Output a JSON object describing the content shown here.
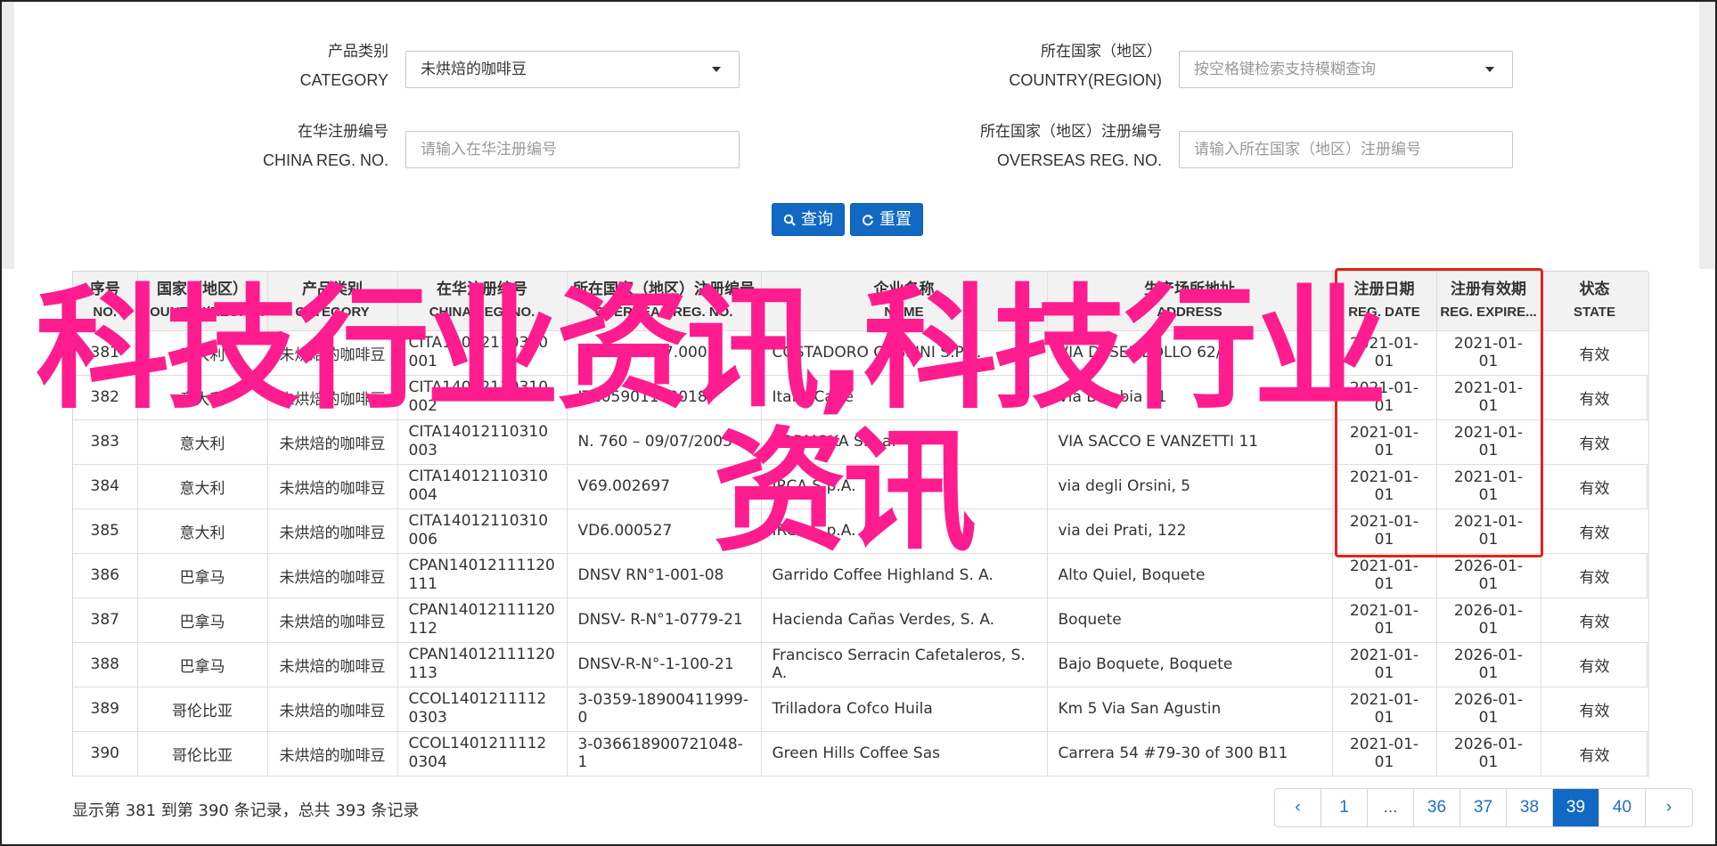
{
  "search": {
    "category_label_cn": "产品类别",
    "category_label_en": "CATEGORY",
    "category_value": "未烘焙的咖啡豆",
    "country_label_cn": "所在国家（地区）",
    "country_label_en": "COUNTRY(REGION)",
    "country_placeholder": "按空格键检索支持模糊查询",
    "china_reg_label_cn": "在华注册编号",
    "china_reg_label_en": "CHINA REG. NO.",
    "china_reg_placeholder": "请输入在华注册编号",
    "overseas_reg_label_cn": "所在国家（地区）注册编号",
    "overseas_reg_label_en": "OVERSEAS REG. NO.",
    "overseas_reg_placeholder": "请输入所在国家（地区）注册编号",
    "query_button": "查询",
    "reset_button": "重置"
  },
  "table": {
    "headers": [
      {
        "cn": "序号",
        "en": "NO."
      },
      {
        "cn": "国家（地区）",
        "en": "COUNTRY(REGIO..."
      },
      {
        "cn": "产品类别",
        "en": "CATEGORY"
      },
      {
        "cn": "在华注册编号",
        "en": "CHINA REG. NO."
      },
      {
        "cn": "所在国家（地区）注册编号",
        "en": "OVERSEAS REG. NO."
      },
      {
        "cn": "企业名称",
        "en": "NAME"
      },
      {
        "cn": "生产场所地址",
        "en": "ADDRESS"
      },
      {
        "cn": "注册日期",
        "en": "REG. DATE"
      },
      {
        "cn": "注册有效期",
        "en": "REG. EXPIRE..."
      },
      {
        "cn": "状态",
        "en": "STATE"
      }
    ],
    "rows": [
      [
        "381",
        "意大利",
        "未烘焙的咖啡豆",
        "CITA14012110310001",
        "IT09.S10117.0001",
        "COSTADORO COSSINI S.P.A.",
        "VIA DESEMBOLLO 62/A",
        "2021-01-01",
        "2021-01-01",
        "有效"
      ],
      [
        "382",
        "意大利",
        "未烘焙的咖啡豆",
        "CITA14012110310002",
        "IT205901100018",
        "Italvi Caffè",
        "Via Bolobia 21",
        "2021-01-01",
        "2021-01-01",
        "有效"
      ],
      [
        "383",
        "意大利",
        "未烘焙的咖啡豆",
        "CITA14012110310003",
        "N. 760 – 09/07/2003",
        "TORMOKA S.a.a.",
        "VIA SACCO E VANZETTI 11",
        "2021-01-01",
        "2021-01-01",
        "有效"
      ],
      [
        "384",
        "意大利",
        "未烘焙的咖啡豆",
        "CITA14012110310004",
        "V69.002697",
        "IRCA S.p.A.",
        "via degli Orsini, 5",
        "2021-01-01",
        "2021-01-01",
        "有效"
      ],
      [
        "385",
        "意大利",
        "未烘焙的咖啡豆",
        "CITA14012110310006",
        "VD6.000527",
        "IRCA S.p.A.",
        "via dei Prati, 122",
        "2021-01-01",
        "2021-01-01",
        "有效"
      ],
      [
        "386",
        "巴拿马",
        "未烘焙的咖啡豆",
        "CPAN14012111120111",
        "DNSV RN°1-001-08",
        "Garrido Coffee Highland S. A.",
        "Alto Quiel, Boquete",
        "2021-01-01",
        "2026-01-01",
        "有效"
      ],
      [
        "387",
        "巴拿马",
        "未烘焙的咖啡豆",
        "CPAN14012111120112",
        "DNSV- R-N°1-0779-21",
        "Hacienda Cañas Verdes, S. A.",
        "Boquete",
        "2021-01-01",
        "2026-01-01",
        "有效"
      ],
      [
        "388",
        "巴拿马",
        "未烘焙的咖啡豆",
        "CPAN14012111120113",
        "DNSV-R-N°-1-100-21",
        "Francisco Serracin Cafetaleros, S. A.",
        "Bajo Boquete, Boquete",
        "2021-01-01",
        "2026-01-01",
        "有效"
      ],
      [
        "389",
        "哥伦比亚",
        "未烘焙的咖啡豆",
        "CCOL14012111120303",
        "3-0359-18900411999-0",
        "Trilladora Cofco Huila",
        "Km 5 Via San Agustin",
        "2021-01-01",
        "2026-01-01",
        "有效"
      ],
      [
        "390",
        "哥伦比亚",
        "未烘焙的咖啡豆",
        "CCOL14012111120304",
        "3-036618900721048-1",
        "Green Hills Coffee Sas",
        "Carrera 54 #79-30 of 300 B11",
        "2021-01-01",
        "2026-01-01",
        "有效"
      ]
    ]
  },
  "watermark": {
    "line1": "科技行业资讯,科技行业",
    "line2": "资讯"
  },
  "footer": {
    "summary": "显示第 381 到第 390 条记录，总共 393 条记录"
  },
  "pagination": {
    "pages": [
      "‹",
      "1",
      "...",
      "36",
      "37",
      "38",
      "39",
      "40",
      "›"
    ],
    "active": "39"
  },
  "colors": {
    "primary": "#1169c4",
    "highlight_box": "#e0241c",
    "watermark": "#ff1c8e"
  }
}
